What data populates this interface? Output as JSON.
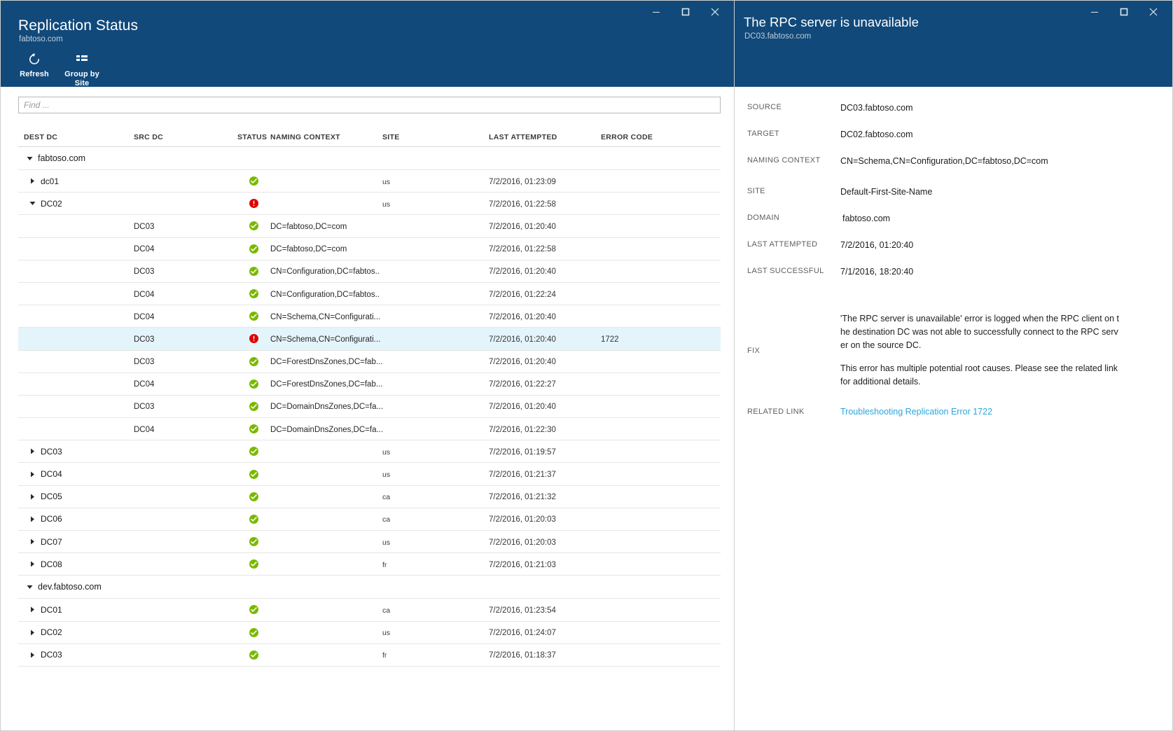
{
  "left_window": {
    "title": "Replication Status",
    "subtitle": "fabtoso.com",
    "window_controls": {
      "minimize": "Minimize",
      "maximize": "Maximize",
      "close": "Close"
    },
    "toolbar": [
      {
        "label": "Refresh",
        "icon": "refresh-icon"
      },
      {
        "label": "Group by\nSite",
        "icon": "group-by-icon"
      }
    ],
    "search": {
      "placeholder": "Find ...",
      "value": ""
    },
    "columns": [
      "DEST DC",
      "SRC DC",
      "STATUS",
      "NAMING CONTEXT",
      "SITE",
      "LAST ATTEMPTED",
      "ERROR CODE"
    ],
    "rows": [
      {
        "kind": "group",
        "twisty": "down",
        "dest": "fabtoso.com",
        "src": "",
        "status": "",
        "nc": "",
        "site": "",
        "last": "",
        "err": ""
      },
      {
        "kind": "node",
        "twisty": "right",
        "dest": "dc01",
        "src": "",
        "status": "ok",
        "nc": "",
        "site": "us",
        "last": "7/2/2016, 01:23:09",
        "err": ""
      },
      {
        "kind": "node",
        "twisty": "down",
        "dest": "DC02",
        "src": "",
        "status": "error",
        "nc": "",
        "site": "us",
        "last": "7/2/2016, 01:22:58",
        "err": ""
      },
      {
        "kind": "leaf",
        "twisty": "",
        "dest": "",
        "src": "DC03",
        "status": "ok",
        "nc": "DC=fabtoso,DC=com",
        "site": "",
        "last": "7/2/2016, 01:20:40",
        "err": ""
      },
      {
        "kind": "leaf",
        "twisty": "",
        "dest": "",
        "src": "DC04",
        "status": "ok",
        "nc": "DC=fabtoso,DC=com",
        "site": "",
        "last": "7/2/2016, 01:22:58",
        "err": ""
      },
      {
        "kind": "leaf",
        "twisty": "",
        "dest": "",
        "src": "DC03",
        "status": "ok",
        "nc": "CN=Configuration,DC=fabtos..",
        "site": "",
        "last": "7/2/2016, 01:20:40",
        "err": ""
      },
      {
        "kind": "leaf",
        "twisty": "",
        "dest": "",
        "src": "DC04",
        "status": "ok",
        "nc": "CN=Configuration,DC=fabtos..",
        "site": "",
        "last": "7/2/2016, 01:22:24",
        "err": ""
      },
      {
        "kind": "leaf",
        "twisty": "",
        "dest": "",
        "src": "DC04",
        "status": "ok",
        "nc": "CN=Schema,CN=Configurati...",
        "site": "",
        "last": "7/2/2016, 01:20:40",
        "err": ""
      },
      {
        "kind": "leaf",
        "selected": true,
        "twisty": "",
        "dest": "",
        "src": "DC03",
        "status": "error",
        "nc": "CN=Schema,CN=Configurati...",
        "site": "",
        "last": "7/2/2016, 01:20:40",
        "err": "1722"
      },
      {
        "kind": "leaf",
        "twisty": "",
        "dest": "",
        "src": "DC03",
        "status": "ok",
        "nc": "DC=ForestDnsZones,DC=fab...",
        "site": "",
        "last": "7/2/2016, 01:20:40",
        "err": ""
      },
      {
        "kind": "leaf",
        "twisty": "",
        "dest": "",
        "src": "DC04",
        "status": "ok",
        "nc": "DC=ForestDnsZones,DC=fab...",
        "site": "",
        "last": "7/2/2016, 01:22:27",
        "err": ""
      },
      {
        "kind": "leaf",
        "twisty": "",
        "dest": "",
        "src": "DC03",
        "status": "ok",
        "nc": "DC=DomainDnsZones,DC=fa...",
        "site": "",
        "last": "7/2/2016, 01:20:40",
        "err": ""
      },
      {
        "kind": "leaf",
        "twisty": "",
        "dest": "",
        "src": "DC04",
        "status": "ok",
        "nc": "DC=DomainDnsZones,DC=fa...",
        "site": "",
        "last": "7/2/2016, 01:22:30",
        "err": ""
      },
      {
        "kind": "node",
        "twisty": "right",
        "dest": "DC03",
        "src": "",
        "status": "ok",
        "nc": "",
        "site": "us",
        "last": "7/2/2016, 01:19:57",
        "err": ""
      },
      {
        "kind": "node",
        "twisty": "right",
        "dest": "DC04",
        "src": "",
        "status": "ok",
        "nc": "",
        "site": "us",
        "last": "7/2/2016, 01:21:37",
        "err": ""
      },
      {
        "kind": "node",
        "twisty": "right",
        "dest": "DC05",
        "src": "",
        "status": "ok",
        "nc": "",
        "site": "ca",
        "last": "7/2/2016, 01:21:32",
        "err": ""
      },
      {
        "kind": "node",
        "twisty": "right",
        "dest": "DC06",
        "src": "",
        "status": "ok",
        "nc": "",
        "site": "ca",
        "last": "7/2/2016, 01:20:03",
        "err": ""
      },
      {
        "kind": "node",
        "twisty": "right",
        "dest": "DC07",
        "src": "",
        "status": "ok",
        "nc": "",
        "site": "us",
        "last": "7/2/2016, 01:20:03",
        "err": ""
      },
      {
        "kind": "node",
        "twisty": "right",
        "dest": "DC08",
        "src": "",
        "status": "ok",
        "nc": "",
        "site": "fr",
        "last": "7/2/2016, 01:21:03",
        "err": ""
      },
      {
        "kind": "group",
        "twisty": "down",
        "dest": "dev.fabtoso.com",
        "src": "",
        "status": "",
        "nc": "",
        "site": "",
        "last": "",
        "err": ""
      },
      {
        "kind": "node",
        "twisty": "right",
        "dest": "DC01",
        "src": "",
        "status": "ok",
        "nc": "",
        "site": "ca",
        "last": "7/2/2016, 01:23:54",
        "err": ""
      },
      {
        "kind": "node",
        "twisty": "right",
        "dest": "DC02",
        "src": "",
        "status": "ok",
        "nc": "",
        "site": "us",
        "last": "7/2/2016, 01:24:07",
        "err": ""
      },
      {
        "kind": "node",
        "twisty": "right",
        "dest": "DC03",
        "src": "",
        "status": "ok",
        "nc": "",
        "site": "fr",
        "last": "7/2/2016, 01:18:37",
        "err": ""
      }
    ]
  },
  "right_window": {
    "title": "The RPC server is unavailable",
    "subtitle": "DC03.fabtoso.com",
    "window_controls": {
      "minimize": "Minimize",
      "maximize": "Maximize",
      "close": "Close"
    },
    "fields": [
      {
        "label": "SOURCE",
        "value": "DC03.fabtoso.com"
      },
      {
        "label": "TARGET",
        "value": "DC02.fabtoso.com"
      },
      {
        "label": "NAMING CONTEXT",
        "value": "CN=Schema,CN=Configuration,DC=fabtoso,DC=com"
      },
      {
        "label": "SITE",
        "value": "Default-First-Site-Name"
      },
      {
        "label": "DOMAIN",
        "value": "fabtoso.com"
      },
      {
        "label": "LAST ATTEMPTED",
        "value": "7/2/2016, 01:20:40"
      },
      {
        "label": "LAST SUCCESSFUL",
        "value": "7/1/2016, 18:20:40"
      }
    ],
    "fix": {
      "label": "FIX",
      "paragraph_1": "'The RPC server is unavailable' error is logged when the RPC client on the destination DC was not able to successfully connect to the RPC server on the source DC.",
      "paragraph_2": "This error has multiple potential root causes. Please see the related link for additional details."
    },
    "related_link": {
      "label": "RELATED LINK",
      "text": "Troubleshooting Replication Error 1722"
    }
  },
  "colors": {
    "header_blue": "#11497a",
    "status_ok_green": "#7ab800",
    "status_error_red": "#e00000",
    "link_cyan": "#2aa6dd",
    "selected_row": "#e4f4fb"
  }
}
